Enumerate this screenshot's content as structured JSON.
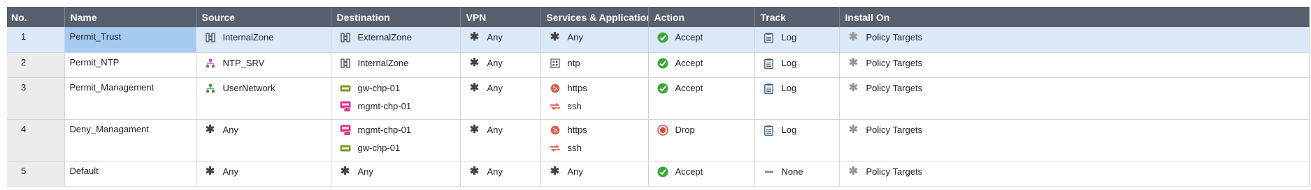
{
  "headers": [
    "No.",
    "Name",
    "Source",
    "Destination",
    "VPN",
    "Services & Applications",
    "Action",
    "Track",
    "Install On"
  ],
  "colors": {
    "header_bg": "#57606d",
    "selected_row": "#dbe9f9",
    "selected_name": "#a6cbf1",
    "accept_green": "#3aa83a",
    "drop_red": "#e04848"
  },
  "rows": [
    {
      "no": "1",
      "name": "Permit_Trust",
      "source": [
        {
          "icon": "zone-icon",
          "label": "InternalZone"
        }
      ],
      "destination": [
        {
          "icon": "zone-icon",
          "label": "ExternalZone"
        }
      ],
      "vpn": {
        "icon": "any-icon",
        "label": "Any"
      },
      "services": [
        {
          "icon": "any-icon",
          "label": "Any"
        }
      ],
      "action": {
        "icon": "accept-icon",
        "label": "Accept"
      },
      "track": {
        "icon": "log-icon",
        "label": "Log"
      },
      "install_on": {
        "icon": "policy-targets-icon",
        "label": "Policy Targets"
      }
    },
    {
      "no": "2",
      "name": "Permit_NTP",
      "source": [
        {
          "icon": "host-group-icon",
          "label": "NTP_SRV"
        }
      ],
      "destination": [
        {
          "icon": "zone-icon",
          "label": "InternalZone"
        }
      ],
      "vpn": {
        "icon": "any-icon",
        "label": "Any"
      },
      "services": [
        {
          "icon": "service-icon",
          "label": "ntp"
        }
      ],
      "action": {
        "icon": "accept-icon",
        "label": "Accept"
      },
      "track": {
        "icon": "log-icon",
        "label": "Log"
      },
      "install_on": {
        "icon": "policy-targets-icon",
        "label": "Policy Targets"
      }
    },
    {
      "no": "3",
      "name": "Permit_Management",
      "source": [
        {
          "icon": "network-icon",
          "label": "UserNetwork"
        }
      ],
      "destination": [
        {
          "icon": "gateway-icon",
          "label": "gw-chp-01"
        },
        {
          "icon": "management-server-icon",
          "label": "mgmt-chp-01"
        }
      ],
      "vpn": {
        "icon": "any-icon",
        "label": "Any"
      },
      "services": [
        {
          "icon": "https-icon",
          "label": "https"
        },
        {
          "icon": "ssh-icon",
          "label": "ssh"
        }
      ],
      "action": {
        "icon": "accept-icon",
        "label": "Accept"
      },
      "track": {
        "icon": "log-icon",
        "label": "Log"
      },
      "install_on": {
        "icon": "policy-targets-icon",
        "label": "Policy Targets"
      }
    },
    {
      "no": "4",
      "name": "Deny_Managament",
      "source": [
        {
          "icon": "any-icon",
          "label": "Any"
        }
      ],
      "destination": [
        {
          "icon": "management-server-icon",
          "label": "mgmt-chp-01"
        },
        {
          "icon": "gateway-icon",
          "label": "gw-chp-01"
        }
      ],
      "vpn": {
        "icon": "any-icon",
        "label": "Any"
      },
      "services": [
        {
          "icon": "https-icon",
          "label": "https"
        },
        {
          "icon": "ssh-icon",
          "label": "ssh"
        }
      ],
      "action": {
        "icon": "drop-icon",
        "label": "Drop"
      },
      "track": {
        "icon": "log-icon",
        "label": "Log"
      },
      "install_on": {
        "icon": "policy-targets-icon",
        "label": "Policy Targets"
      }
    },
    {
      "no": "5",
      "name": "Default",
      "source": [
        {
          "icon": "any-icon",
          "label": "Any"
        }
      ],
      "destination": [
        {
          "icon": "any-icon",
          "label": "Any"
        }
      ],
      "vpn": {
        "icon": "any-icon",
        "label": "Any"
      },
      "services": [
        {
          "icon": "any-icon",
          "label": "Any"
        }
      ],
      "action": {
        "icon": "accept-icon",
        "label": "Accept"
      },
      "track": {
        "icon": "none-icon",
        "label": "None"
      },
      "install_on": {
        "icon": "policy-targets-icon",
        "label": "Policy Targets"
      }
    }
  ]
}
